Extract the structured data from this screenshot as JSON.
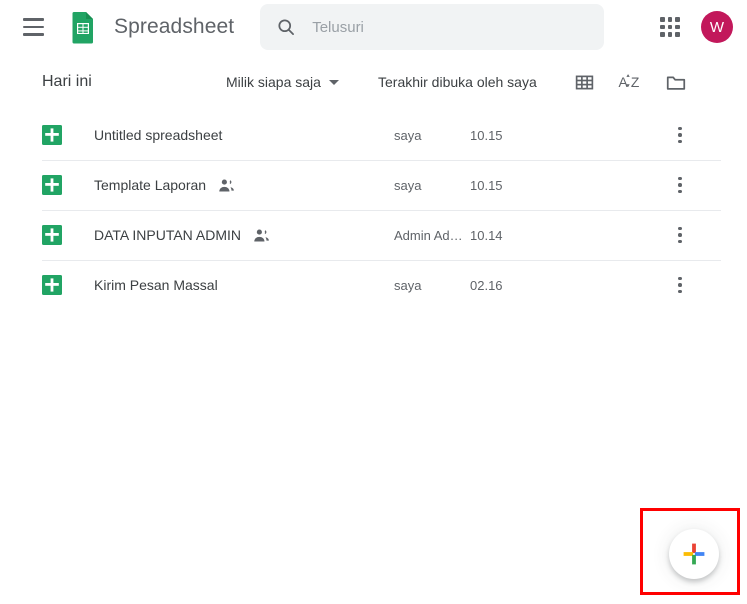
{
  "header": {
    "menu_icon": "hamburger-menu-icon",
    "logo_icon": "google-sheets-logo",
    "title": "Spreadsheet",
    "search": {
      "icon": "search-icon",
      "placeholder": "Telusuri",
      "value": ""
    },
    "apps_icon": "google-apps-grid-icon",
    "avatar_initial": "W",
    "avatar_color": "#c2185b"
  },
  "toolbar": {
    "section_title": "Hari ini",
    "owner_filter": "Milik siapa saja",
    "sort_label": "Terakhir dibuka oleh saya",
    "grid_view_icon": "grid-view-icon",
    "sort_az_icon": "sort-alphabetical-icon",
    "folder_icon": "folder-icon"
  },
  "files": [
    {
      "icon": "sheets-file-icon",
      "name": "Untitled spreadsheet",
      "shared": false,
      "owner": "saya",
      "time": "10.15",
      "menu_icon": "more-options-icon"
    },
    {
      "icon": "sheets-file-icon",
      "name": "Template Laporan",
      "shared": true,
      "shared_icon": "shared-people-icon",
      "owner": "saya",
      "time": "10.15",
      "menu_icon": "more-options-icon"
    },
    {
      "icon": "sheets-file-icon",
      "name": "DATA INPUTAN ADMIN",
      "shared": true,
      "shared_icon": "shared-people-icon",
      "owner": "Admin Ad…",
      "time": "10.14",
      "menu_icon": "more-options-icon"
    },
    {
      "icon": "sheets-file-icon",
      "name": "Kirim Pesan Massal",
      "shared": false,
      "owner": "saya",
      "time": "02.16",
      "menu_icon": "more-options-icon"
    }
  ],
  "fab": {
    "icon": "google-plus-create-icon",
    "colors": {
      "red": "#ea4335",
      "yellow": "#fbbc04",
      "blue": "#4285f4",
      "green": "#34a853"
    },
    "highlight_color": "#ff0000"
  },
  "colors": {
    "sheets_green": "#21a464",
    "text_primary": "#3c4043",
    "text_secondary": "#5f6368",
    "search_bg": "#f1f3f4",
    "divider": "#e8eaed"
  }
}
